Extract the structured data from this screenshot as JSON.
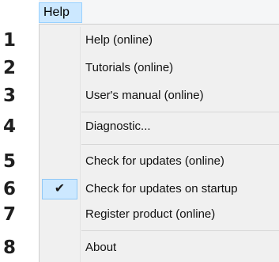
{
  "menubar": {
    "title": "Help"
  },
  "items": [
    {
      "label": "Help (online)"
    },
    {
      "label": "Tutorials (online)"
    },
    {
      "label": "User's manual (online)"
    },
    {
      "label": "Diagnostic..."
    },
    {
      "label": "Check for updates (online)"
    },
    {
      "label": "Check for updates on startup",
      "checked": true
    },
    {
      "label": "Register product (online)"
    },
    {
      "label": "About"
    }
  ],
  "numbers": [
    "1",
    "2",
    "3",
    "4",
    "5",
    "6",
    "7",
    "8"
  ],
  "icons": {
    "check": "checkmark-icon"
  },
  "colors": {
    "highlight": "#cce8ff",
    "menu_background": "#f0f0f0"
  }
}
